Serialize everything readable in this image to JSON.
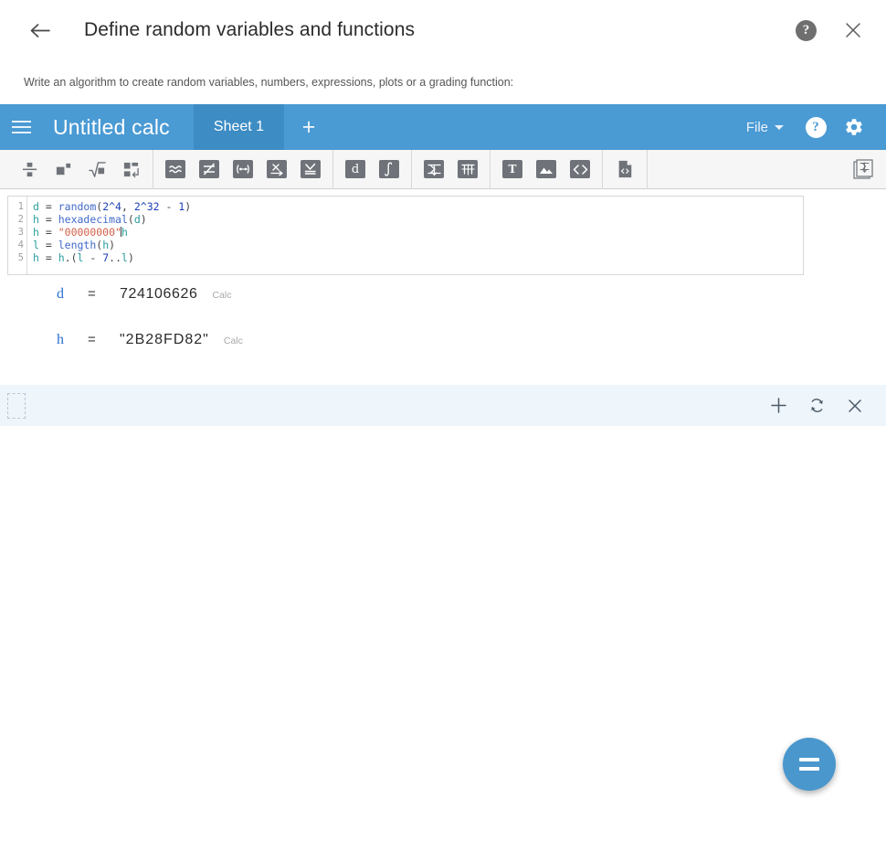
{
  "dialog": {
    "title": "Define random variables and functions",
    "subtitle": "Write an algorithm to create random variables, numbers, expressions, plots or a grading function:",
    "back_icon": "arrow-left-icon",
    "help_icon": "help-icon",
    "help_glyph": "?",
    "close_icon": "close-icon",
    "close_glyph": "✕"
  },
  "appbar": {
    "menu_icon": "hamburger-menu-icon",
    "doc_title": "Untitled calc",
    "tabs": [
      {
        "label": "Sheet 1",
        "active": true
      }
    ],
    "add_tab_label": "+",
    "file_menu_label": "File",
    "help_glyph": "?",
    "settings_icon": "gear-icon",
    "bar_color": "#4a9ad4",
    "tab_active_color": "#3d8cc4"
  },
  "toolbar": {
    "groups": [
      {
        "buttons": [
          {
            "name": "fraction-icon",
            "title": "Fraction"
          },
          {
            "name": "exponent-icon",
            "title": "Exponent"
          },
          {
            "name": "square-root-icon",
            "title": "Square root"
          },
          {
            "name": "matrix-newline-icon",
            "title": "Matrix"
          }
        ]
      },
      {
        "buttons": [
          {
            "name": "approx-equal-icon",
            "title": "Approximately equal"
          },
          {
            "name": "not-equal-diagonal-icon",
            "title": "Not equal"
          },
          {
            "name": "interval-icon",
            "title": "Interval"
          },
          {
            "name": "limit-icon",
            "title": "Limit"
          },
          {
            "name": "evaluate-icon",
            "title": "Evaluate"
          }
        ]
      },
      {
        "buttons": [
          {
            "name": "derivative-icon",
            "title": "Derivative"
          },
          {
            "name": "integral-icon",
            "title": "Integral"
          }
        ]
      },
      {
        "buttons": [
          {
            "name": "summation-icon",
            "title": "Summation"
          },
          {
            "name": "product-icon",
            "title": "Product"
          }
        ]
      },
      {
        "buttons": [
          {
            "name": "text-icon",
            "title": "Text"
          },
          {
            "name": "image-icon",
            "title": "Image"
          },
          {
            "name": "code-brackets-icon",
            "title": "Code"
          }
        ]
      },
      {
        "buttons": [
          {
            "name": "file-code-icon",
            "title": "Code file"
          }
        ]
      }
    ],
    "trailing": {
      "name": "export-stack-icon",
      "title": "Export"
    }
  },
  "editor": {
    "line_numbers": [
      "1",
      "2",
      "3",
      "4",
      "5"
    ],
    "lines": [
      "d = random(2^4, 2^32 - 1)",
      "h = hexadecimal(d)",
      "h = \"00000000\"|h",
      "l = length(h)",
      "h = h.(l - 7..l)"
    ]
  },
  "results": [
    {
      "name": "d",
      "equals": "=",
      "value": "724106626",
      "tag": "Calc"
    },
    {
      "name": "h",
      "equals": "=",
      "value": "\"2B28FD82\"",
      "tag": "Calc"
    }
  ],
  "action_bar": {
    "add_icon": "plus-icon",
    "add_glyph": "+",
    "refresh_icon": "refresh-icon",
    "close_icon": "close-icon",
    "close_glyph": "✕",
    "background": "#eef5fb"
  },
  "fab": {
    "name": "equals-fab",
    "label": "=",
    "color": "#4a97ce"
  }
}
